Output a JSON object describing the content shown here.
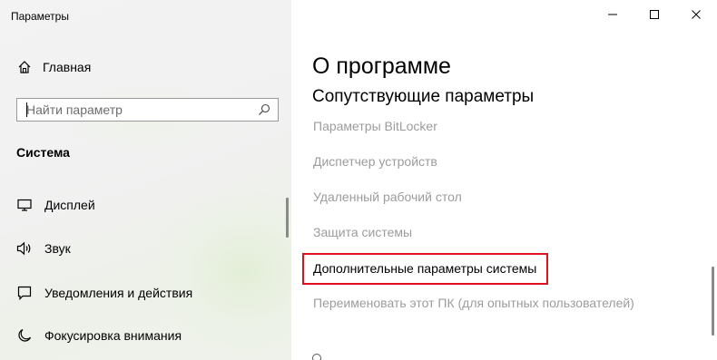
{
  "window": {
    "title": "Параметры",
    "controls": {
      "minimize_icon": "minimize-icon",
      "maximize_icon": "maximize-icon",
      "close_icon": "close-icon"
    }
  },
  "sidebar": {
    "home": {
      "label": "Главная",
      "icon": "home-icon"
    },
    "search": {
      "placeholder": "Найти параметр",
      "value": "",
      "icon": "search-icon"
    },
    "section_heading": "Система",
    "items": [
      {
        "label": "Дисплей",
        "icon": "monitor-icon"
      },
      {
        "label": "Звук",
        "icon": "speaker-icon"
      },
      {
        "label": "Уведомления и действия",
        "icon": "notification-icon"
      },
      {
        "label": "Фокусировка внимания",
        "icon": "moon-icon"
      }
    ]
  },
  "main": {
    "page_title": "О программе",
    "section_title": "Сопутствующие параметры",
    "links": [
      {
        "label": "Параметры BitLocker"
      },
      {
        "label": "Диспетчер устройств"
      },
      {
        "label": "Удаленный рабочий стол"
      },
      {
        "label": "Защита системы"
      },
      {
        "label": "Дополнительные параметры системы",
        "highlighted": true
      },
      {
        "label": "Переименовать этот ПК (для опытных пользователей)"
      }
    ],
    "highlight_color": "#e0101e",
    "link_color": "#9c9c9c"
  }
}
